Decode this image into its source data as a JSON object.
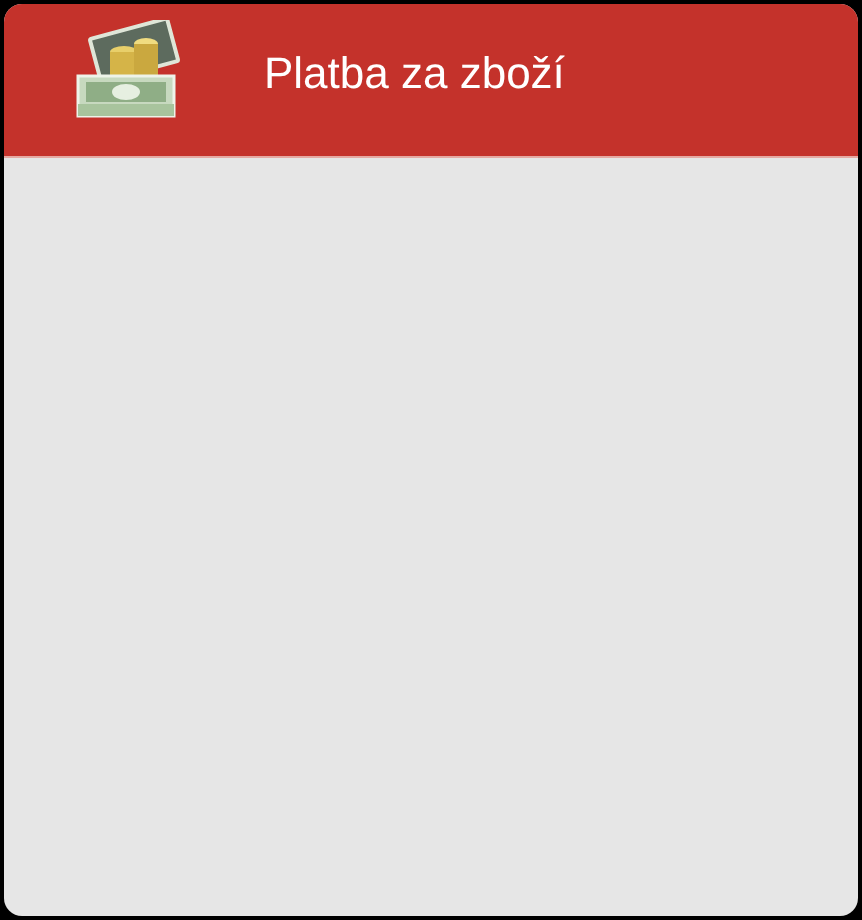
{
  "header": {
    "title": "Platba za zboží"
  }
}
